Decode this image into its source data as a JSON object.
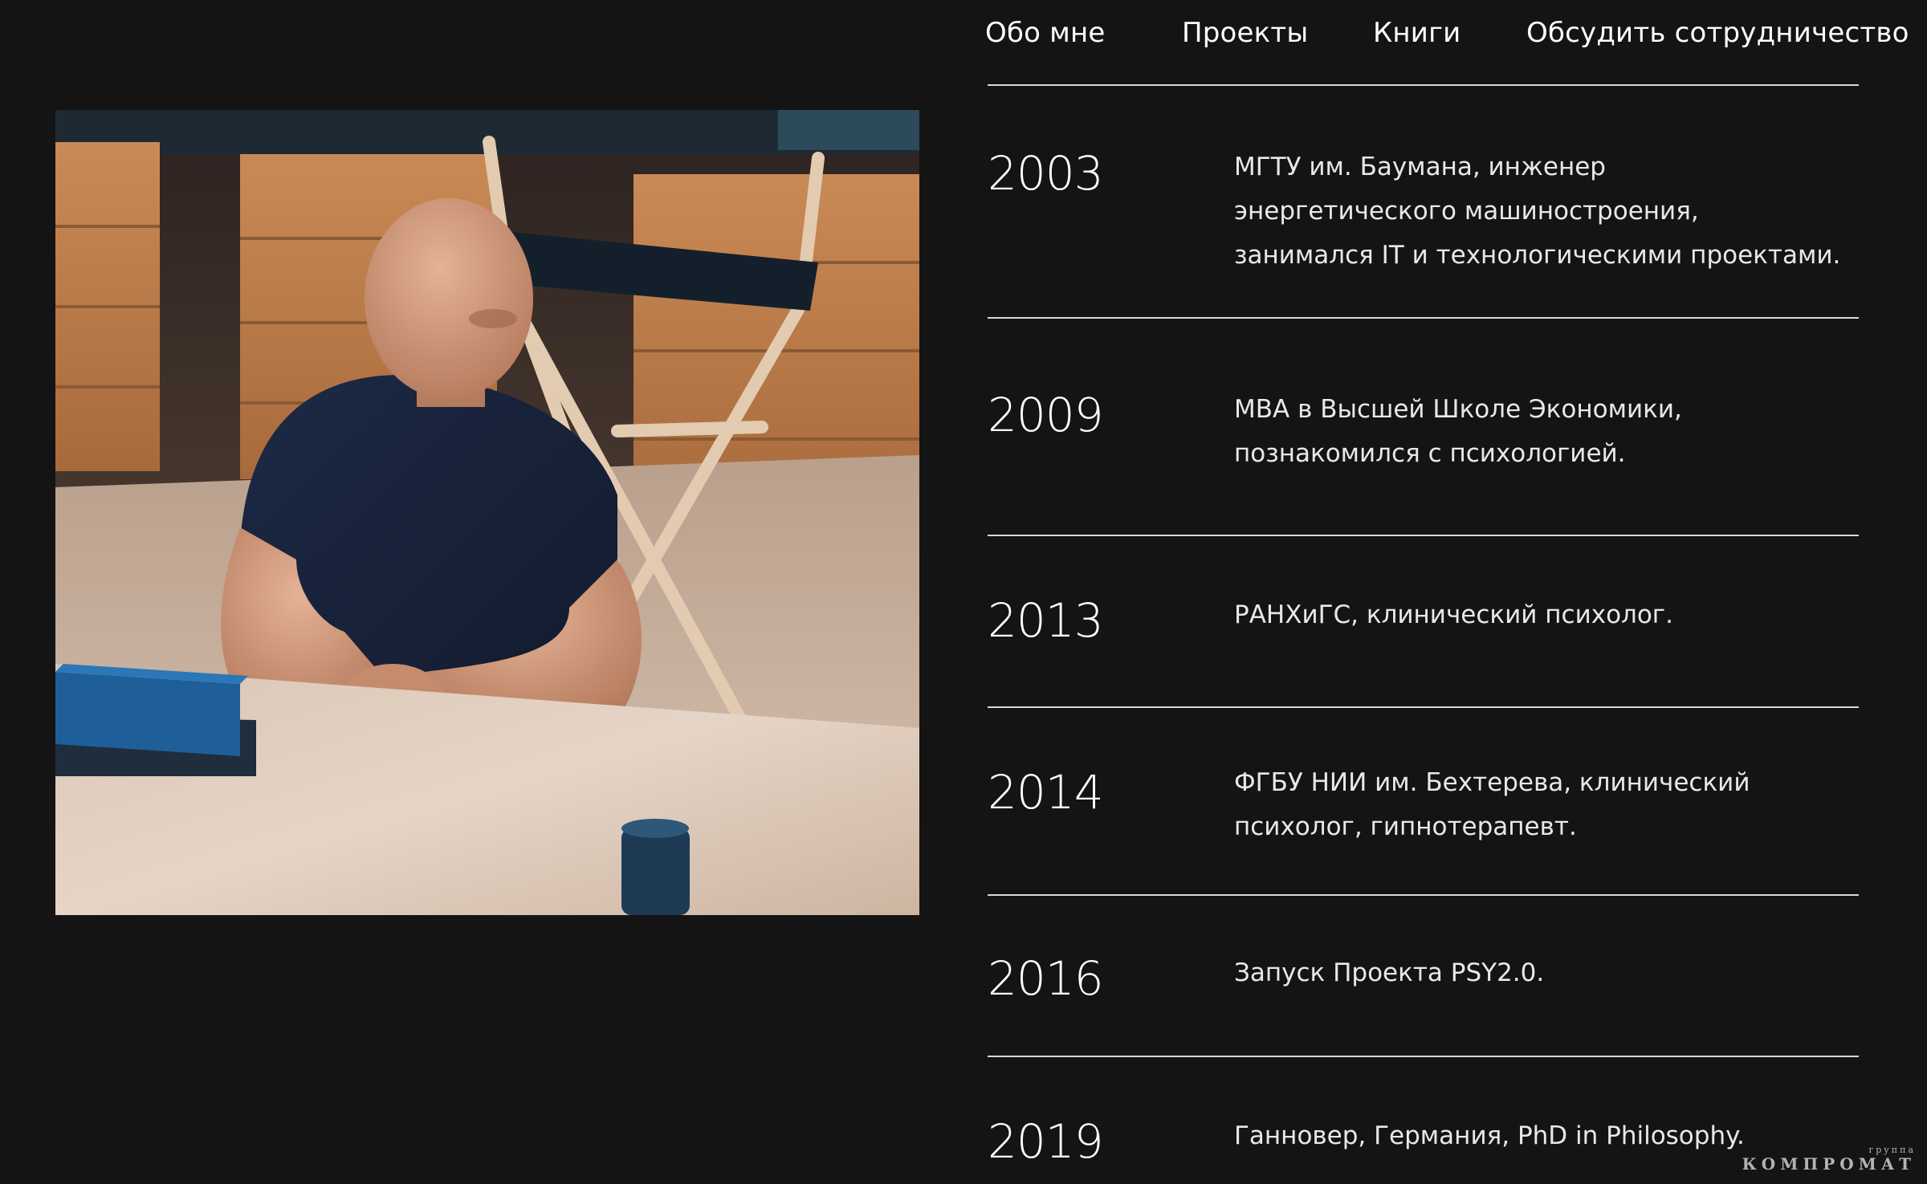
{
  "nav": {
    "items": [
      {
        "label": "Обо мне"
      },
      {
        "label": "Проекты"
      },
      {
        "label": "Книги"
      },
      {
        "label": "Обсудить сотрудничество"
      }
    ]
  },
  "photo": {
    "description_icon": "portrait-photo"
  },
  "timeline": [
    {
      "year": "2003",
      "lines": [
        "МГТУ им. Баумана, инженер",
        "энергетического машиностроения,",
        "занимался IT и технологическими проектами."
      ]
    },
    {
      "year": "2009",
      "lines": [
        "МВА в Высшей Школе Экономики,",
        "познакомился с психологией."
      ]
    },
    {
      "year": "2013",
      "lines": [
        "РАНХиГС, клинический психолог."
      ]
    },
    {
      "year": "2014",
      "lines": [
        "ФГБУ НИИ им. Бехтерева, клинический",
        "психолог, гипнотерапевт."
      ]
    },
    {
      "year": "2016",
      "lines": [
        "Запуск Проекта PSY2.0."
      ]
    },
    {
      "year": "2019",
      "lines": [
        "Ганновер, Германия, PhD in Philosophy."
      ]
    }
  ],
  "watermark": {
    "small": "группа",
    "big": "КОМПРОМАТ"
  },
  "colors": {
    "background": "#141414",
    "text": "#ffffff",
    "divider": "#d9d9d9"
  }
}
